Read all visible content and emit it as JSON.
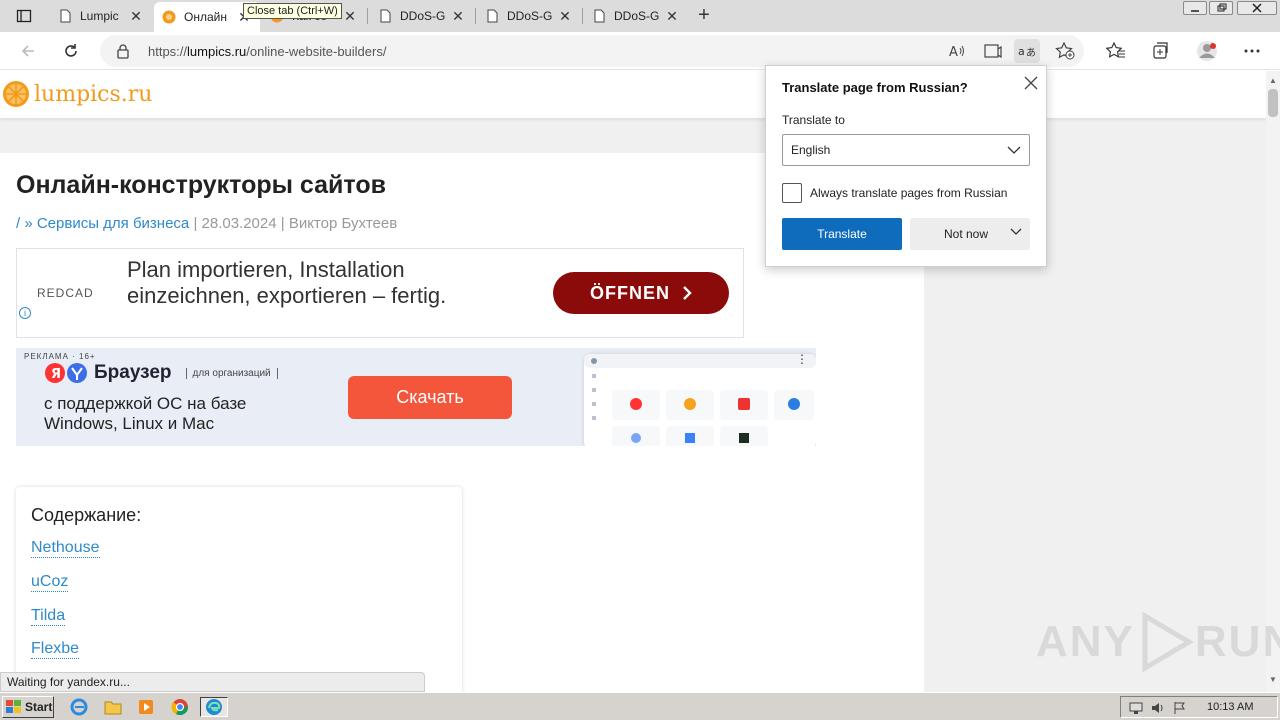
{
  "browser": {
    "tabs": [
      {
        "title": "Lumpic",
        "favicon": "page-icon",
        "active": false
      },
      {
        "title": "Онлайн",
        "favicon": "orange-icon",
        "active": true
      },
      {
        "title": "Как со",
        "favicon": "orange-icon",
        "active": false
      },
      {
        "title": "DDoS-G",
        "favicon": "page-icon",
        "active": false
      },
      {
        "title": "DDoS-G",
        "favicon": "page-icon",
        "active": false
      },
      {
        "title": "DDoS-G",
        "favicon": "page-icon",
        "active": false
      }
    ],
    "tooltip": "Close tab (Ctrl+W)",
    "url_prefix": "https://",
    "url_domain": "lumpics.ru",
    "url_path": "/online-website-builders/",
    "status_text": "Waiting for yandex.ru..."
  },
  "site": {
    "logo_text": "lumpics.ru",
    "article_title": "Онлайн-конструкторы сайтов",
    "breadcrumb_link": "/ » Сервисы для бизнеса",
    "meta_rest": " | 28.03.2024 | Виктор Бухтеев"
  },
  "ad1": {
    "brand": "REDCAD",
    "line1": "Plan importieren, Installation",
    "line2": "einzeichnen, exportieren – fertig.",
    "cta": "ÖFFNEN"
  },
  "ad2": {
    "label": "РЕКЛАМА · 16+",
    "brand": "Браузер",
    "org": "для организаций",
    "line1": "с поддержкой ОС на базе",
    "line2": "Windows, Linux и Mac",
    "cta": "Скачать"
  },
  "toc": {
    "heading": "Содержание:",
    "items": [
      "Nethouse",
      "uCoz",
      "Tilda",
      "Flexbe"
    ]
  },
  "translate_popup": {
    "title": "Translate page from Russian?",
    "translate_to_label": "Translate to",
    "language": "English",
    "always_label": "Always translate pages from Russian",
    "always_checked": false,
    "translate_button": "Translate",
    "not_now_button": "Not now"
  },
  "watermark": {
    "left": "ANY",
    "right": "RUN"
  },
  "taskbar": {
    "start_label": "Start",
    "clock": "10:13 AM"
  },
  "colors": {
    "accent_blue": "#0f6cbd",
    "link_blue": "#2f8ac9",
    "logo_orange": "#f39a1c",
    "ad_red": "#8b0a0a",
    "yandex_cta": "#f4563c"
  }
}
